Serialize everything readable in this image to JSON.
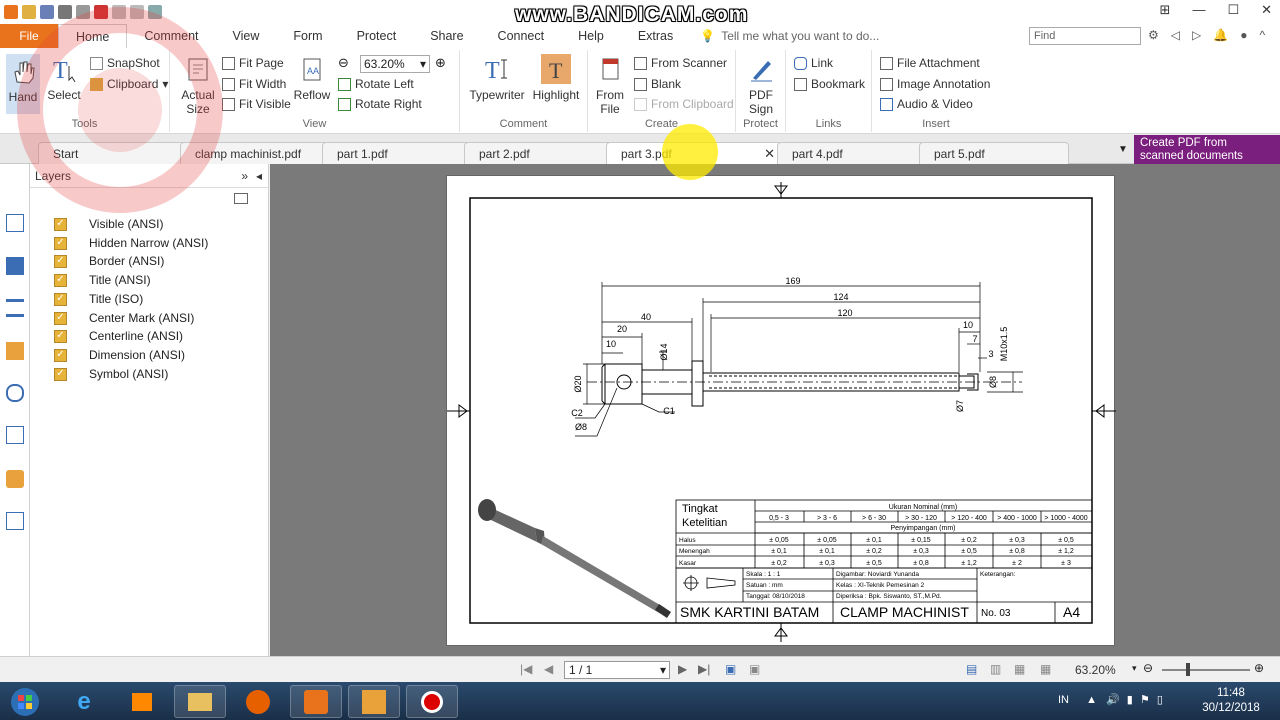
{
  "watermark": "www.BANDICAM.com",
  "menu": {
    "file": "File",
    "tabs": [
      "Home",
      "Comment",
      "View",
      "Form",
      "Protect",
      "Share",
      "Connect",
      "Help",
      "Extras"
    ],
    "tell_me": "Tell me what you want to do...",
    "find_placeholder": "Find"
  },
  "ribbon": {
    "tools": {
      "label": "Tools",
      "hand": "Hand",
      "select": "Select",
      "snapshot": "SnapShot",
      "clipboard": "Clipboard"
    },
    "view": {
      "label": "View",
      "actual_size": [
        "Actual",
        "Size"
      ],
      "fit_page": "Fit Page",
      "fit_width": "Fit Width",
      "fit_visible": "Fit Visible",
      "reflow": "Reflow",
      "zoom": "63.20%",
      "rotate_left": "Rotate Left",
      "rotate_right": "Rotate Right"
    },
    "comment": {
      "label": "Comment",
      "typewriter": "Typewriter",
      "highlight": "Highlight"
    },
    "create": {
      "label": "Create",
      "from_file": [
        "From",
        "File"
      ],
      "from_scanner": "From Scanner",
      "blank": "Blank",
      "from_clipboard": "From Clipboard"
    },
    "protect": {
      "label": "Protect",
      "pdf_sign": [
        "PDF",
        "Sign"
      ]
    },
    "links": {
      "label": "Links",
      "link": "Link",
      "bookmark": "Bookmark"
    },
    "insert": {
      "label": "Insert",
      "file_attachment": "File Attachment",
      "image_annotation": "Image Annotation",
      "audio_video": "Audio & Video"
    }
  },
  "doc_tabs": [
    "Start",
    "clamp machinist.pdf",
    "part 1.pdf",
    "part 2.pdf",
    "part 3.pdf",
    "part 4.pdf",
    "part 5.pdf"
  ],
  "create_pdf_banner": [
    "Create PDF from",
    "scanned documents"
  ],
  "layers": {
    "title": "Layers",
    "items": [
      "Visible (ANSI)",
      "Hidden Narrow (ANSI)",
      "Border (ANSI)",
      "Title (ANSI)",
      "Title (ISO)",
      "Center Mark (ANSI)",
      "Centerline (ANSI)",
      "Dimension (ANSI)",
      "Symbol (ANSI)"
    ]
  },
  "drawing": {
    "dims": {
      "d169": "169",
      "d124": "124",
      "d120": "120",
      "d40": "40",
      "d20": "20",
      "d10a": "10",
      "d10b": "10",
      "d7": "7",
      "d3": "3",
      "thread": "M10x1.5",
      "dia14": "Ø14",
      "dia20": "Ø20",
      "dia8a": "Ø8",
      "dia8b": "Ø8",
      "dia7": "Ø7",
      "c2": "C2",
      "c1": "C1"
    },
    "tolerance": {
      "tingkat": [
        "Tingkat",
        "Ketelitian"
      ],
      "ukuran": "Ukuran Nominal (mm)",
      "penyimpangan": "Penyimpangan (mm)",
      "ranges": [
        "0,5 - 3",
        "> 3 - 6",
        "> 6 - 30",
        "> 30 - 120",
        "> 120 - 400",
        "> 400 - 1000",
        "> 1000 - 4000"
      ],
      "rows": [
        {
          "name": "Halus",
          "vals": [
            "± 0,05",
            "± 0,05",
            "± 0,1",
            "± 0,15",
            "± 0,2",
            "± 0,3",
            "± 0,5"
          ]
        },
        {
          "name": "Menengah",
          "vals": [
            "± 0,1",
            "± 0,1",
            "± 0,2",
            "± 0,3",
            "± 0,5",
            "± 0,8",
            "± 1,2"
          ]
        },
        {
          "name": "Kasar",
          "vals": [
            "± 0,2",
            "± 0,3",
            "± 0,5",
            "± 0,8",
            "± 1,2",
            "± 2",
            "± 3"
          ]
        }
      ]
    },
    "title_block": {
      "skala": "Skala    : 1 : 1",
      "satuan": "Satuan  : mm",
      "tanggal": "Tanggal: 08/10/2018",
      "digambar": "Digambar: Noviardi Yunanda",
      "kelas": "Kelas       : XI-Teknik Pemesinan 2",
      "diperiksa": "Diperiksa : Bpk. Siswanto, ST.,M.Pd.",
      "keterangan": "Keterangan:",
      "school": "SMK KARTINI BATAM",
      "part_name": "CLAMP MACHINIST",
      "number": "No. 03",
      "size": "A4"
    }
  },
  "status": {
    "page": "1 / 1",
    "zoom": "63.20%"
  },
  "taskbar": {
    "lang": "IN",
    "time": "11:48",
    "date": "30/12/2018"
  }
}
